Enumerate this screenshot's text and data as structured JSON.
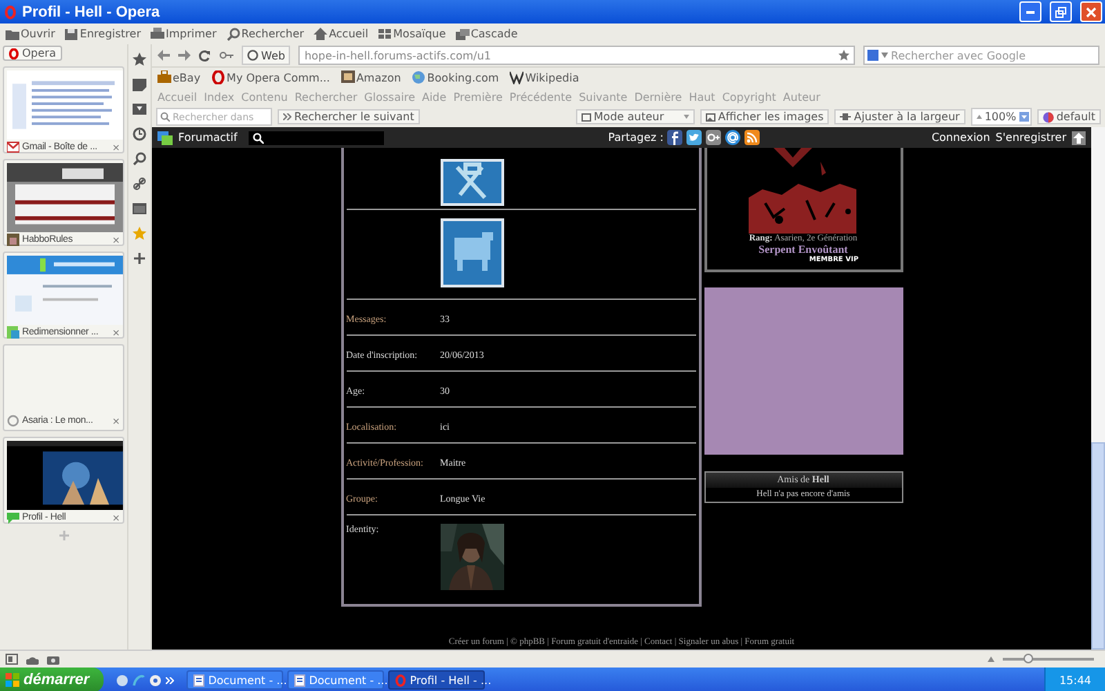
{
  "window": {
    "title": "Profil - Hell - Opera"
  },
  "menu": [
    {
      "label": "Ouvrir"
    },
    {
      "label": "Enregistrer"
    },
    {
      "label": "Imprimer"
    },
    {
      "label": "Rechercher"
    },
    {
      "label": "Accueil"
    },
    {
      "label": "Mosaïque"
    },
    {
      "label": "Cascade"
    }
  ],
  "panel": {
    "opera_button": "Opera",
    "tabs": [
      {
        "title": "Gmail - Boîte de ...",
        "close": "×"
      },
      {
        "title": "HabboRules",
        "close": "×"
      },
      {
        "title": "Redimensionner ...",
        "close": "×"
      },
      {
        "title": "Asaria : Le mon...",
        "close": "×"
      },
      {
        "title": "Profil - Hell",
        "close": "×"
      }
    ]
  },
  "address": {
    "web": "Web",
    "url": "hope-in-hell.forums-actifs.com/u1",
    "search_placeholder": "Rechercher avec Google"
  },
  "bookmarks": [
    {
      "label": "eBay"
    },
    {
      "label": "My Opera Comm..."
    },
    {
      "label": "Amazon"
    },
    {
      "label": "Booking.com"
    },
    {
      "label": "Wikipedia"
    }
  ],
  "nav_links": [
    "Accueil",
    "Index",
    "Contenu",
    "Rechercher",
    "Glossaire",
    "Aide",
    "Première",
    "Précédente",
    "Suivante",
    "Dernière",
    "Haut",
    "Copyright",
    "Auteur"
  ],
  "find_bar": {
    "placeholder": "Rechercher dans",
    "next": "Rechercher le suivant",
    "mode": "Mode auteur",
    "images": "Afficher les images",
    "fit": "Ajuster à la largeur",
    "zoom": "100%",
    "style": "default"
  },
  "forum_bar": {
    "brand": "Forumactif",
    "share": "Partagez :",
    "login": "Connexion",
    "register": "S'enregistrer"
  },
  "profile": {
    "fields": [
      {
        "kind": "text",
        "label": "Messages:",
        "color": "#c9a27e",
        "value": "33"
      },
      {
        "kind": "text",
        "label": "Date d'inscription:",
        "color": "#d8d8d8",
        "value": "20/06/2013"
      },
      {
        "kind": "text",
        "label": "Age:",
        "color": "#d8d8d8",
        "value": "30"
      },
      {
        "kind": "text",
        "label": "Localisation:",
        "color": "#c9a27e",
        "value": "ici"
      },
      {
        "kind": "text",
        "label": "Activité/Profession:",
        "color": "#c9a27e",
        "value": "Maitre"
      },
      {
        "kind": "text",
        "label": "Groupe:",
        "color": "#c9a27e",
        "value": "Longue Vie"
      },
      {
        "kind": "picture",
        "label": "Identity:",
        "color": "#d8d8d8"
      }
    ]
  },
  "rank": {
    "label": "Rang:",
    "value": "Asarien, 2e Génération",
    "title": "Serpent Envoûtant",
    "badge": "MEMBRE VIP"
  },
  "friends": {
    "title": "Amis de **Hell**",
    "empty": "Hell n'a pas encore d'amis"
  },
  "footer": "Créer un forum | © phpBB | Forum gratuit d'entraide | Contact | Signaler un abus | Forum gratuit",
  "zoom_slider": {
    "level": 0.28
  },
  "taskbar": {
    "start": "démarrer",
    "tasks": [
      {
        "label": "Document - ...",
        "selected": false
      },
      {
        "label": "Document - ...",
        "selected": false
      },
      {
        "label": "Profil - Hell - ...",
        "selected": true
      }
    ],
    "clock": "15:44"
  }
}
